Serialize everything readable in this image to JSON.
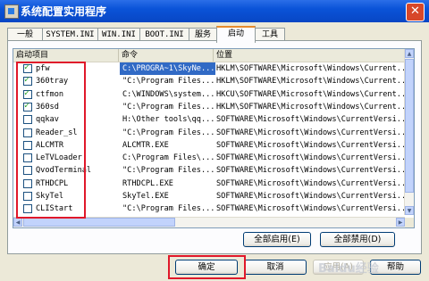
{
  "window": {
    "title": "系统配置实用程序",
    "close_glyph": "✕"
  },
  "tabs": [
    {
      "label": "一般"
    },
    {
      "label": "SYSTEM.INI"
    },
    {
      "label": "WIN.INI"
    },
    {
      "label": "BOOT.INI"
    },
    {
      "label": "服务"
    },
    {
      "label": "启动",
      "active": true
    },
    {
      "label": "工具"
    }
  ],
  "columns": [
    {
      "label": "启动项目"
    },
    {
      "label": "命令"
    },
    {
      "label": "位置"
    }
  ],
  "startup_items": [
    {
      "checked": true,
      "name": "pfw",
      "command": "C:\\PROGRA~1\\SkyNe...",
      "location": "HKLM\\SOFTWARE\\Microsoft\\Windows\\Current...",
      "selected": true
    },
    {
      "checked": true,
      "name": "360tray",
      "command": "\"C:\\Program Files...",
      "location": "HKLM\\SOFTWARE\\Microsoft\\Windows\\Current..."
    },
    {
      "checked": true,
      "name": "ctfmon",
      "command": "C:\\WINDOWS\\system...",
      "location": "HKCU\\SOFTWARE\\Microsoft\\Windows\\Current..."
    },
    {
      "checked": true,
      "name": "360sd",
      "command": "\"C:\\Program Files...",
      "location": "HKLM\\SOFTWARE\\Microsoft\\Windows\\Current..."
    },
    {
      "checked": false,
      "name": "qqkav",
      "command": "H:\\Other tools\\qq...",
      "location": "SOFTWARE\\Microsoft\\Windows\\CurrentVersi..."
    },
    {
      "checked": false,
      "name": "Reader_sl",
      "command": "\"C:\\Program Files...",
      "location": "SOFTWARE\\Microsoft\\Windows\\CurrentVersi..."
    },
    {
      "checked": false,
      "name": "ALCMTR",
      "command": "ALCMTR.EXE",
      "location": "SOFTWARE\\Microsoft\\Windows\\CurrentVersi..."
    },
    {
      "checked": false,
      "name": "LeTVLoader",
      "command": "C:\\Program Files\\...",
      "location": "SOFTWARE\\Microsoft\\Windows\\CurrentVersi..."
    },
    {
      "checked": false,
      "name": "QvodTerminal",
      "command": "\"C:\\Program Files...",
      "location": "SOFTWARE\\Microsoft\\Windows\\CurrentVersi..."
    },
    {
      "checked": false,
      "name": "RTHDCPL",
      "command": "RTHDCPL.EXE",
      "location": "SOFTWARE\\Microsoft\\Windows\\CurrentVersi..."
    },
    {
      "checked": false,
      "name": "SkyTel",
      "command": "SkyTel.EXE",
      "location": "SOFTWARE\\Microsoft\\Windows\\CurrentVersi..."
    },
    {
      "checked": false,
      "name": "CLIStart",
      "command": "\"C:\\Program Files...",
      "location": "SOFTWARE\\Microsoft\\Windows\\CurrentVersi..."
    }
  ],
  "buttons": {
    "enable_all": "全部启用(E)",
    "disable_all": "全部禁用(D)",
    "ok": "确定",
    "cancel": "取消",
    "apply": "应用(A)",
    "help": "帮助"
  },
  "watermark": "Baidu经验",
  "colors": {
    "title_bar": "#0a53d8",
    "selection": "#316ac5",
    "highlight_box": "#e0182a"
  }
}
